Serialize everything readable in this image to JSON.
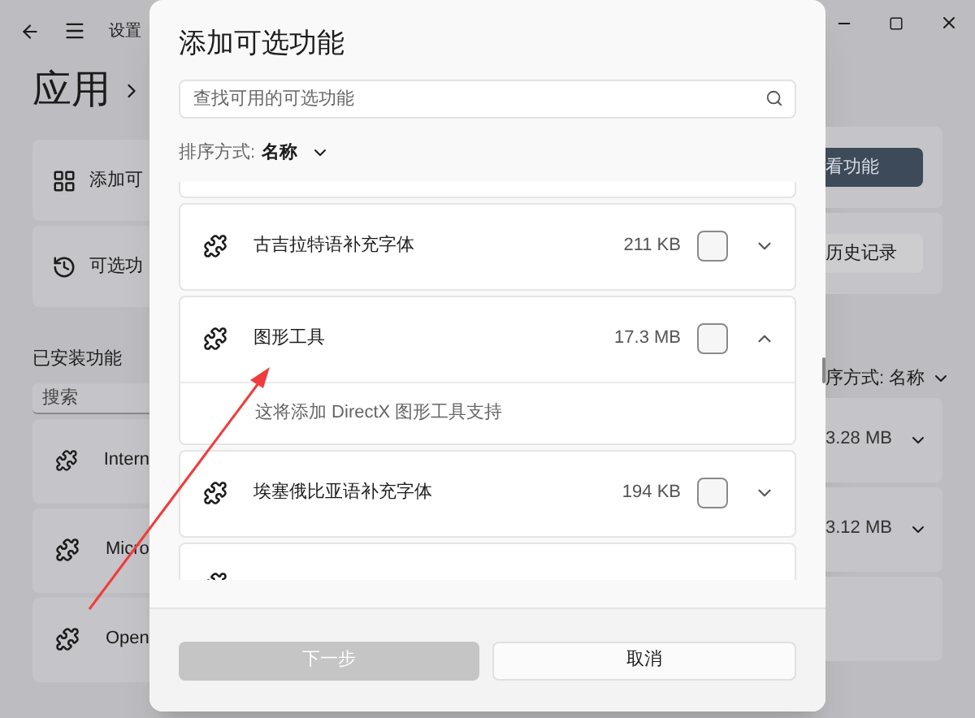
{
  "background": {
    "window_title": "设置",
    "page_title": "应用",
    "cards": [
      {
        "label": "添加可",
        "kind": "add",
        "button": "看功能",
        "primary": true
      },
      {
        "label": "可选功",
        "kind": "history",
        "button": "历史记录",
        "primary": false
      }
    ],
    "installed_heading": "已安装功能",
    "search": {
      "placeholder": "搜索"
    },
    "sort": "序方式: 名称",
    "rows": [
      {
        "name": "Intern",
        "size": "3.28 MB"
      },
      {
        "name": "Micro",
        "size": "3.12 MB"
      },
      {
        "name": "Open",
        "size": ""
      }
    ]
  },
  "dialog": {
    "title": "添加可选功能",
    "search": {
      "placeholder": "查找可用的可选功能"
    },
    "sort_label": "排序方式:",
    "sort_value": "名称",
    "features": [
      {
        "name": "古吉拉特语补充字体",
        "size": "211 KB",
        "checked": false,
        "expanded": false
      },
      {
        "name": "图形工具",
        "size": "17.3 MB",
        "checked": false,
        "expanded": true,
        "description": "这将添加 DirectX 图形工具支持"
      },
      {
        "name": "埃塞俄比亚语补充字体",
        "size": "194 KB",
        "checked": false,
        "expanded": false
      }
    ],
    "buttons": [
      {
        "label": "下一步",
        "disabled": true
      },
      {
        "label": "取消",
        "disabled": false
      }
    ]
  }
}
